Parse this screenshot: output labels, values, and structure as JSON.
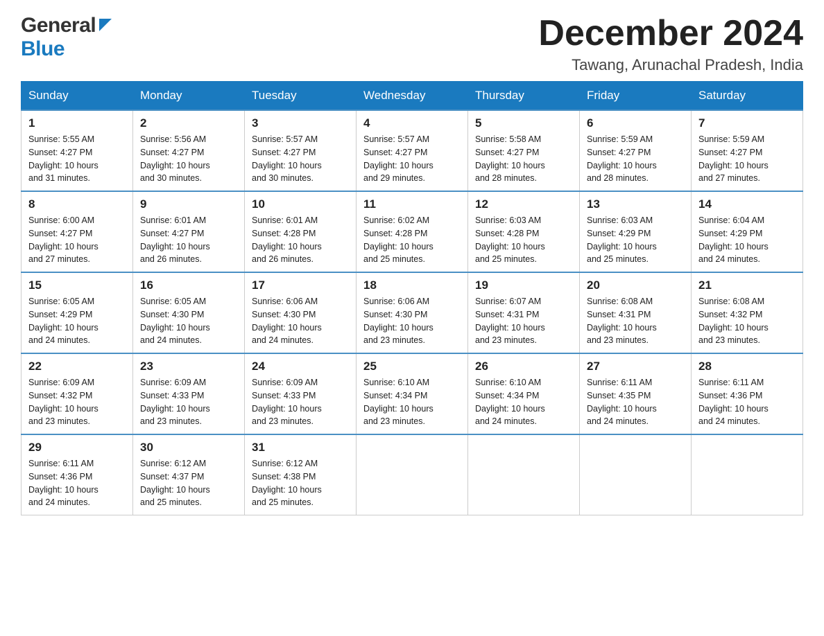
{
  "header": {
    "title": "December 2024",
    "subtitle": "Tawang, Arunachal Pradesh, India",
    "logo_general": "General",
    "logo_blue": "Blue"
  },
  "days": [
    "Sunday",
    "Monday",
    "Tuesday",
    "Wednesday",
    "Thursday",
    "Friday",
    "Saturday"
  ],
  "weeks": [
    [
      {
        "day": "1",
        "sunrise": "5:55 AM",
        "sunset": "4:27 PM",
        "daylight": "10 hours and 31 minutes."
      },
      {
        "day": "2",
        "sunrise": "5:56 AM",
        "sunset": "4:27 PM",
        "daylight": "10 hours and 30 minutes."
      },
      {
        "day": "3",
        "sunrise": "5:57 AM",
        "sunset": "4:27 PM",
        "daylight": "10 hours and 30 minutes."
      },
      {
        "day": "4",
        "sunrise": "5:57 AM",
        "sunset": "4:27 PM",
        "daylight": "10 hours and 29 minutes."
      },
      {
        "day": "5",
        "sunrise": "5:58 AM",
        "sunset": "4:27 PM",
        "daylight": "10 hours and 28 minutes."
      },
      {
        "day": "6",
        "sunrise": "5:59 AM",
        "sunset": "4:27 PM",
        "daylight": "10 hours and 28 minutes."
      },
      {
        "day": "7",
        "sunrise": "5:59 AM",
        "sunset": "4:27 PM",
        "daylight": "10 hours and 27 minutes."
      }
    ],
    [
      {
        "day": "8",
        "sunrise": "6:00 AM",
        "sunset": "4:27 PM",
        "daylight": "10 hours and 27 minutes."
      },
      {
        "day": "9",
        "sunrise": "6:01 AM",
        "sunset": "4:27 PM",
        "daylight": "10 hours and 26 minutes."
      },
      {
        "day": "10",
        "sunrise": "6:01 AM",
        "sunset": "4:28 PM",
        "daylight": "10 hours and 26 minutes."
      },
      {
        "day": "11",
        "sunrise": "6:02 AM",
        "sunset": "4:28 PM",
        "daylight": "10 hours and 25 minutes."
      },
      {
        "day": "12",
        "sunrise": "6:03 AM",
        "sunset": "4:28 PM",
        "daylight": "10 hours and 25 minutes."
      },
      {
        "day": "13",
        "sunrise": "6:03 AM",
        "sunset": "4:29 PM",
        "daylight": "10 hours and 25 minutes."
      },
      {
        "day": "14",
        "sunrise": "6:04 AM",
        "sunset": "4:29 PM",
        "daylight": "10 hours and 24 minutes."
      }
    ],
    [
      {
        "day": "15",
        "sunrise": "6:05 AM",
        "sunset": "4:29 PM",
        "daylight": "10 hours and 24 minutes."
      },
      {
        "day": "16",
        "sunrise": "6:05 AM",
        "sunset": "4:30 PM",
        "daylight": "10 hours and 24 minutes."
      },
      {
        "day": "17",
        "sunrise": "6:06 AM",
        "sunset": "4:30 PM",
        "daylight": "10 hours and 24 minutes."
      },
      {
        "day": "18",
        "sunrise": "6:06 AM",
        "sunset": "4:30 PM",
        "daylight": "10 hours and 23 minutes."
      },
      {
        "day": "19",
        "sunrise": "6:07 AM",
        "sunset": "4:31 PM",
        "daylight": "10 hours and 23 minutes."
      },
      {
        "day": "20",
        "sunrise": "6:08 AM",
        "sunset": "4:31 PM",
        "daylight": "10 hours and 23 minutes."
      },
      {
        "day": "21",
        "sunrise": "6:08 AM",
        "sunset": "4:32 PM",
        "daylight": "10 hours and 23 minutes."
      }
    ],
    [
      {
        "day": "22",
        "sunrise": "6:09 AM",
        "sunset": "4:32 PM",
        "daylight": "10 hours and 23 minutes."
      },
      {
        "day": "23",
        "sunrise": "6:09 AM",
        "sunset": "4:33 PM",
        "daylight": "10 hours and 23 minutes."
      },
      {
        "day": "24",
        "sunrise": "6:09 AM",
        "sunset": "4:33 PM",
        "daylight": "10 hours and 23 minutes."
      },
      {
        "day": "25",
        "sunrise": "6:10 AM",
        "sunset": "4:34 PM",
        "daylight": "10 hours and 23 minutes."
      },
      {
        "day": "26",
        "sunrise": "6:10 AM",
        "sunset": "4:34 PM",
        "daylight": "10 hours and 24 minutes."
      },
      {
        "day": "27",
        "sunrise": "6:11 AM",
        "sunset": "4:35 PM",
        "daylight": "10 hours and 24 minutes."
      },
      {
        "day": "28",
        "sunrise": "6:11 AM",
        "sunset": "4:36 PM",
        "daylight": "10 hours and 24 minutes."
      }
    ],
    [
      {
        "day": "29",
        "sunrise": "6:11 AM",
        "sunset": "4:36 PM",
        "daylight": "10 hours and 24 minutes."
      },
      {
        "day": "30",
        "sunrise": "6:12 AM",
        "sunset": "4:37 PM",
        "daylight": "10 hours and 25 minutes."
      },
      {
        "day": "31",
        "sunrise": "6:12 AM",
        "sunset": "4:38 PM",
        "daylight": "10 hours and 25 minutes."
      },
      null,
      null,
      null,
      null
    ]
  ],
  "labels": {
    "sunrise": "Sunrise:",
    "sunset": "Sunset:",
    "daylight": "Daylight:"
  }
}
